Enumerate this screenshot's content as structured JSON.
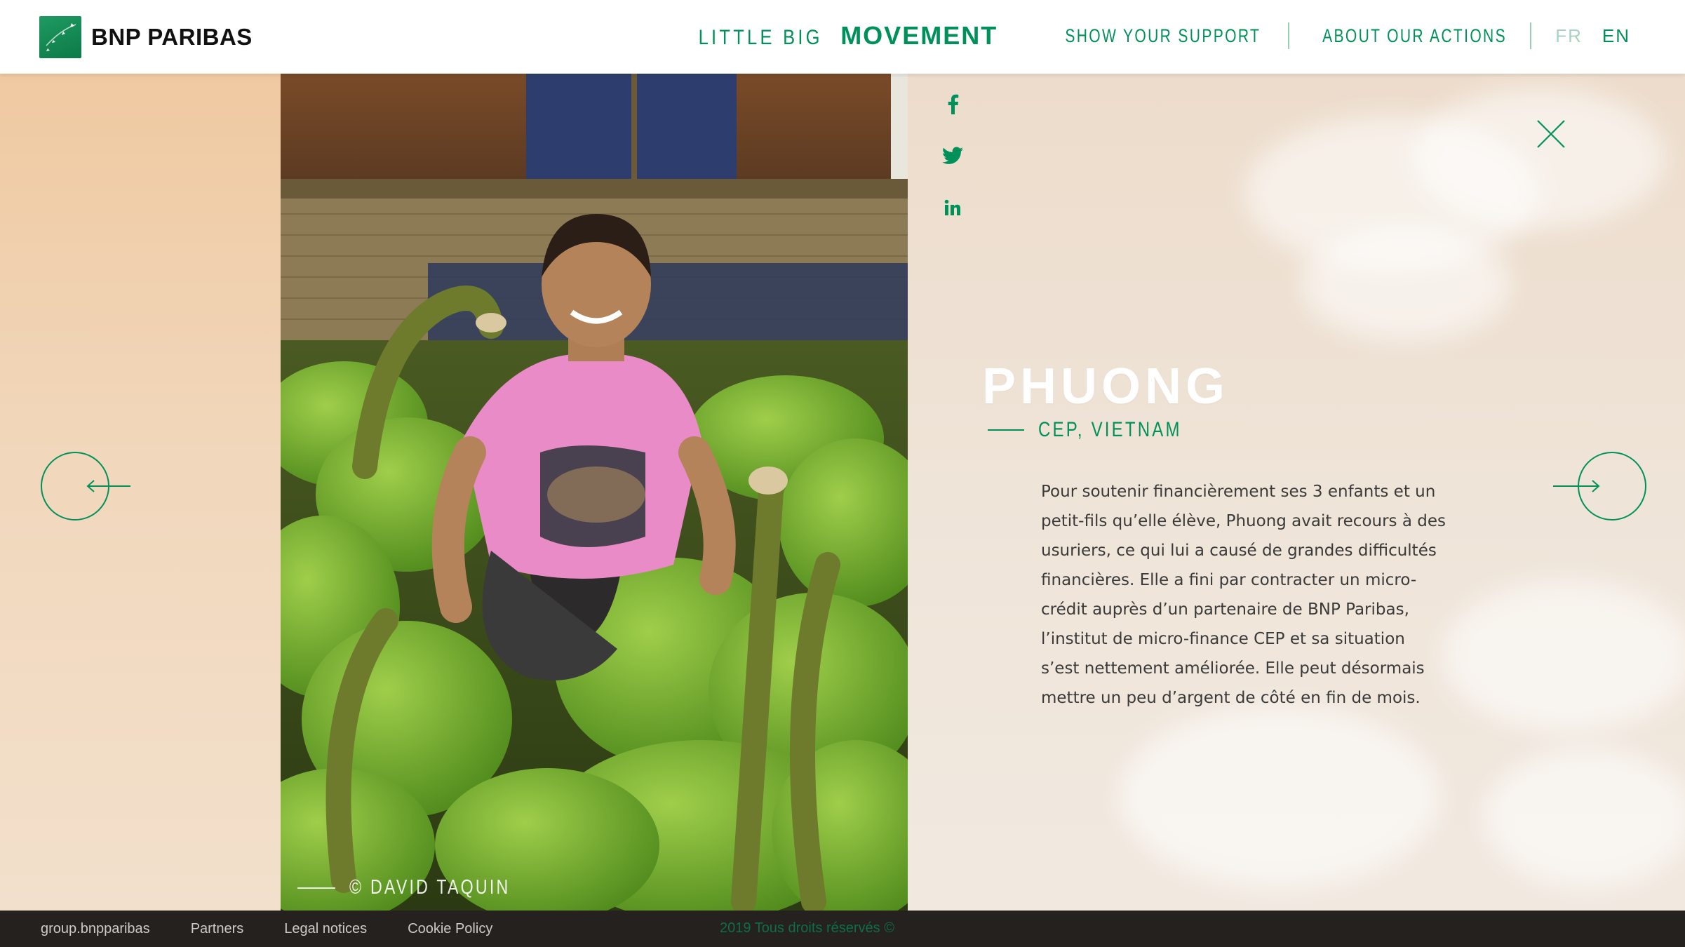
{
  "header": {
    "logo_text": "BNP PARIBAS",
    "brand_light": "LITTLE BIG",
    "brand_bold": "MOVEMENT",
    "nav": [
      {
        "label": "SHOW YOUR SUPPORT"
      },
      {
        "label": "ABOUT OUR ACTIONS"
      }
    ],
    "languages": {
      "fr": "FR",
      "en": "EN",
      "active": "EN"
    }
  },
  "social": [
    "facebook-icon",
    "twitter-icon",
    "linkedin-icon"
  ],
  "photo": {
    "credit": "© DAVID TAQUIN"
  },
  "story": {
    "name": "PHUONG",
    "subtitle": "CEP, VIETNAM",
    "body": "Pour soutenir financièrement ses 3 enfants et un petit-fils qu’elle élève, Phuong avait recours à des usuriers, ce qui lui a causé de grandes difficultés financières. Elle a fini par contracter un micro-crédit auprès d’un partenaire de BNP Paribas, l’institut de micro-finance CEP et sa situation s’est nettement améliorée. Elle peut désormais mettre un peu d’argent de côté en fin de mois."
  },
  "footer": {
    "links": [
      "group.bnpparibas",
      "Partners",
      "Legal notices",
      "Cookie Policy"
    ],
    "copyright": "2019 Tous droits réservés ©"
  },
  "colors": {
    "brand_green": "#00915a",
    "footer_bg": "#24211e",
    "header_bg": "#ffffff"
  }
}
